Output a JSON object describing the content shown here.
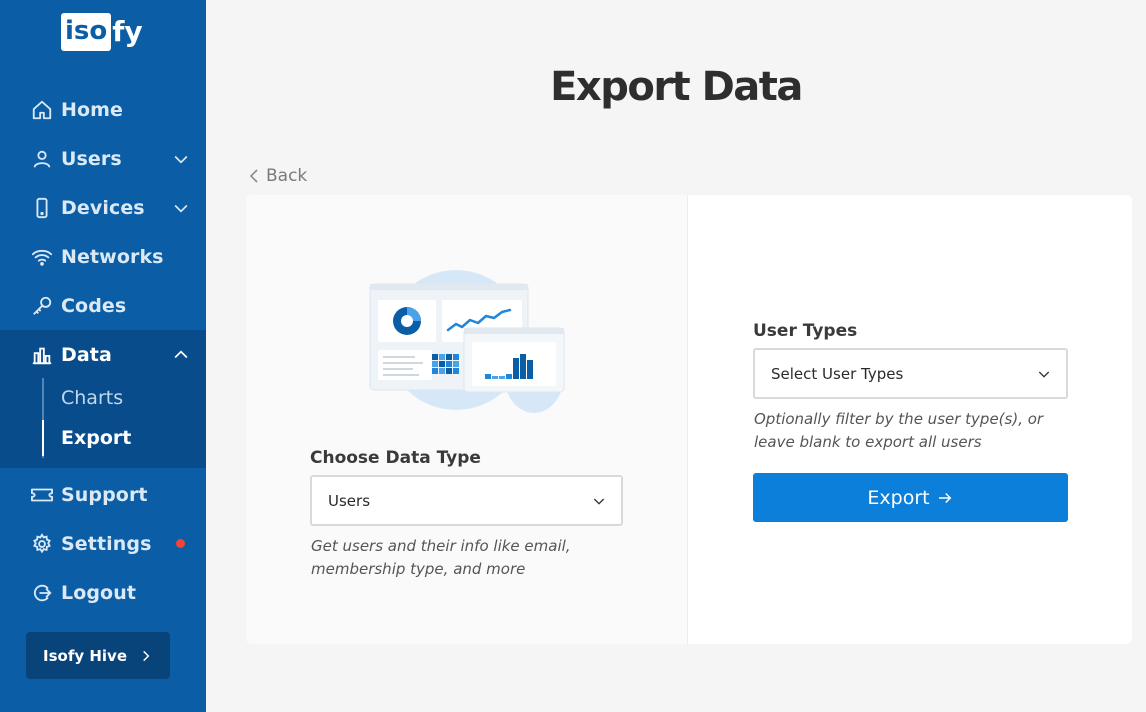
{
  "sidebar": {
    "logo_box": "iso",
    "logo_rest": "fy",
    "items": [
      {
        "label": "Home",
        "icon": "home-icon"
      },
      {
        "label": "Users",
        "icon": "user-icon"
      },
      {
        "label": "Devices",
        "icon": "device-icon"
      },
      {
        "label": "Networks",
        "icon": "wifi-icon"
      },
      {
        "label": "Codes",
        "icon": "key-icon"
      },
      {
        "label": "Data",
        "icon": "bar-chart-icon"
      },
      {
        "label": "Support",
        "icon": "ticket-icon"
      },
      {
        "label": "Settings",
        "icon": "gear-icon"
      },
      {
        "label": "Logout",
        "icon": "logout-icon"
      }
    ],
    "data_subitems": [
      {
        "label": "Charts",
        "active": false
      },
      {
        "label": "Export",
        "active": true
      }
    ],
    "hive_button": "Isofy Hive"
  },
  "main": {
    "title": "Export Data",
    "back_label": "Back",
    "data_type": {
      "label": "Choose Data Type",
      "selected": "Users",
      "hint_line1": "Get users and their info like email,",
      "hint_line2": "membership type, and more"
    },
    "user_types": {
      "label": "User Types",
      "placeholder": "Select User Types",
      "hint_line1": "Optionally filter by the user type(s), or",
      "hint_line2": "leave blank to export all users"
    },
    "export_button": "Export"
  },
  "colors": {
    "sidebar_bg": "#0b5ea6",
    "sidebar_active_bg": "#084c8c",
    "accent": "#0b7fd9",
    "badge": "#f04438"
  }
}
